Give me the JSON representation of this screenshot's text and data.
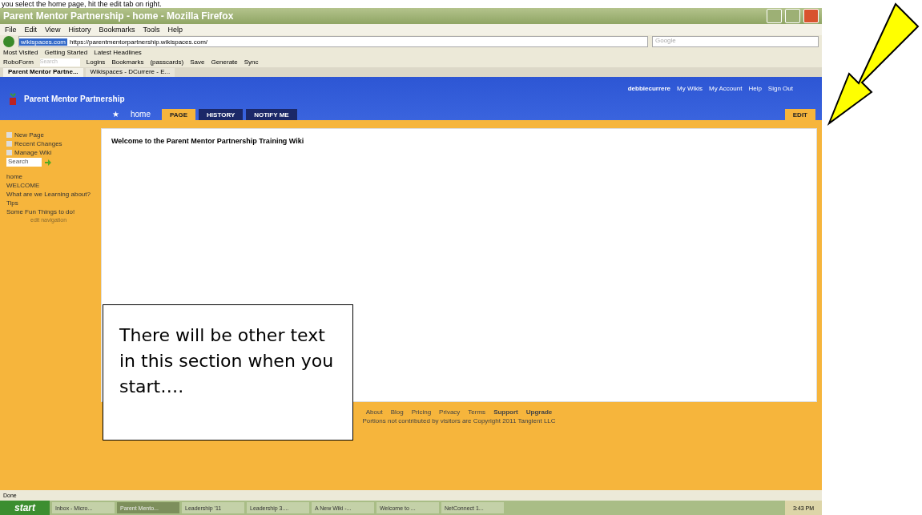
{
  "caption": "you select the home page, hit the edit tab on right.",
  "window": {
    "title": "Parent Mentor Partnership - home - Mozilla Firefox"
  },
  "menu": [
    "File",
    "Edit",
    "View",
    "History",
    "Bookmarks",
    "Tools",
    "Help"
  ],
  "address": {
    "site": "wikispaces.com",
    "url": "https://parentmentorpartnership.wikispaces.com/"
  },
  "search": {
    "placeholder": "Google"
  },
  "bookmarks": [
    "Most Visited",
    "Getting Started",
    "Latest Headlines"
  ],
  "roboform": {
    "label": "RoboForm",
    "search": "Search",
    "items": [
      "Logins",
      "Bookmarks",
      "(passcards)",
      "Save",
      "Generate",
      "Sync"
    ]
  },
  "browser_tabs": [
    {
      "label": "Parent Mentor Partne...",
      "selected": true
    },
    {
      "label": "Wikispaces - DCurrere - E...",
      "selected": false
    }
  ],
  "site": {
    "title": "Parent Mentor Partnership",
    "user_links": [
      "debbiecurrere",
      "My Wikis",
      "My Account",
      "Help",
      "Sign Out"
    ]
  },
  "page_tabs": {
    "star": "★",
    "page_name": "home",
    "tabs": [
      {
        "label": "PAGE",
        "selected": true
      },
      {
        "label": "HISTORY",
        "selected": false
      },
      {
        "label": "NOTIFY ME",
        "selected": false
      }
    ],
    "edit": "EDIT"
  },
  "sidebar": {
    "actions": [
      "New Page",
      "Recent Changes",
      "Manage Wiki"
    ],
    "search": "Search",
    "nav": [
      "home",
      "WELCOME",
      "What are we Learning about?",
      "Tips",
      "Some Fun Things to do!"
    ],
    "edit_nav": "edit navigation"
  },
  "content": {
    "heading": "Welcome to the Parent Mentor Partnership Training Wiki"
  },
  "callout": "There will be other text in this section when you start….",
  "footer": {
    "links": [
      {
        "label": "About",
        "bold": false
      },
      {
        "label": "Blog",
        "bold": false
      },
      {
        "label": "Pricing",
        "bold": false
      },
      {
        "label": "Privacy",
        "bold": false
      },
      {
        "label": "Terms",
        "bold": false
      },
      {
        "label": "Support",
        "bold": true
      },
      {
        "label": "Upgrade",
        "bold": true
      }
    ],
    "copyright": "Portions not contributed by visitors are Copyright 2011 Tangient LLC"
  },
  "status_bar": "Done",
  "taskbar": {
    "start": "start",
    "items": [
      {
        "label": "Inbox - Micro...",
        "selected": false
      },
      {
        "label": "Parent Mento...",
        "selected": true
      },
      {
        "label": "Leadership '11",
        "selected": false
      },
      {
        "label": "Leadership 3....",
        "selected": false
      },
      {
        "label": "A New Wiki -...",
        "selected": false
      },
      {
        "label": "Welcome to ...",
        "selected": false
      },
      {
        "label": "NetConnect 1...",
        "selected": false
      }
    ],
    "clock": "3:43 PM"
  }
}
